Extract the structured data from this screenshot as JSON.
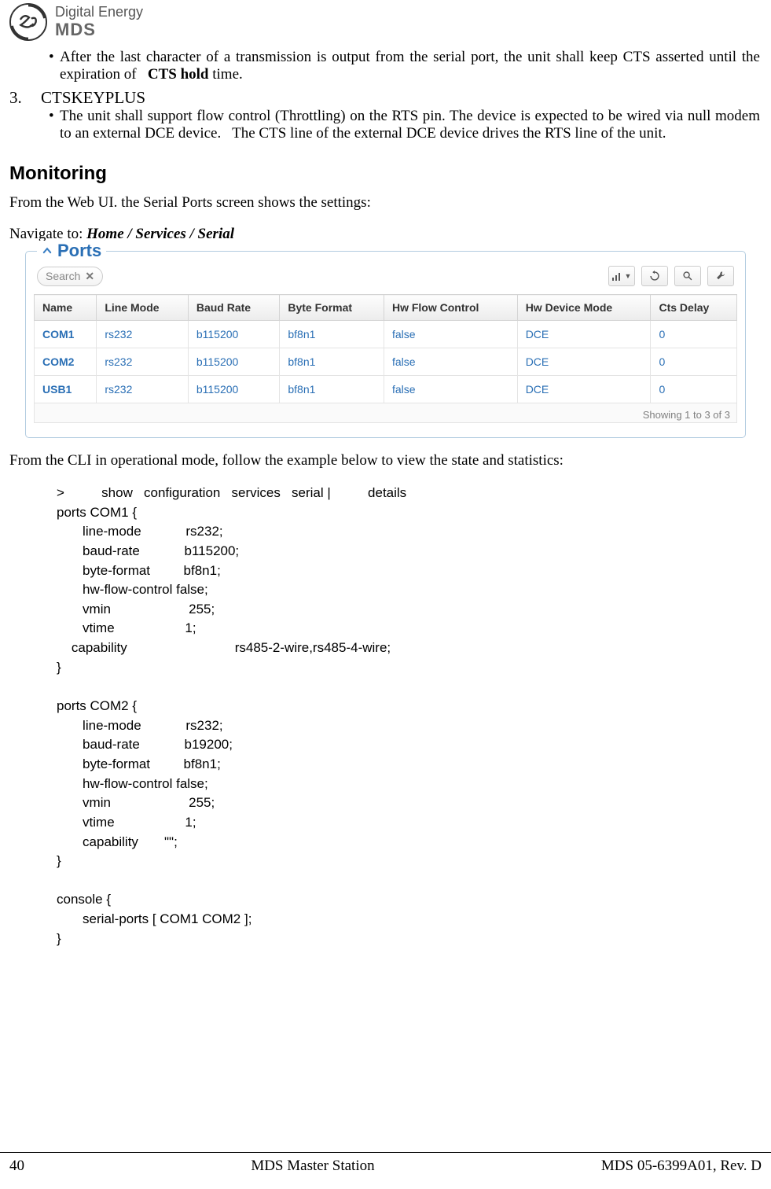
{
  "header": {
    "brand_line1": "Digital Energy",
    "brand_line2": "MDS"
  },
  "body": {
    "bullet1": "After the last character of a transmission is output from the serial port, the unit shall keep CTS asserted until the expiration of   ",
    "bullet1_bold": "CTS hold",
    "bullet1_after": " time.",
    "list3_num": "3.",
    "list3_label": "CTSKEYPLUS",
    "bullet2": "The unit shall support flow control (Throttling) on the RTS pin. The device is expected to be wired via null modem to an external DCE device.   The CTS line of the external DCE device drives the RTS line of the unit.",
    "monitoring_heading": "Monitoring",
    "mon_para1": "From the Web UI. the Serial Ports screen shows the settings:",
    "nav_prefix": "Navigate to: ",
    "nav_path": "Home / Services / Serial",
    "cli_intro": "From the CLI in operational mode, follow the example below to view the state and statistics:"
  },
  "ports_panel": {
    "title": "Ports",
    "search_placeholder": "Search",
    "columns": [
      "Name",
      "Line Mode",
      "Baud Rate",
      "Byte Format",
      "Hw Flow Control",
      "Hw Device Mode",
      "Cts Delay"
    ],
    "rows": [
      {
        "name": "COM1",
        "line_mode": "rs232",
        "baud_rate": "b115200",
        "byte_format": "bf8n1",
        "hw_flow": "false",
        "hw_device": "DCE",
        "cts_delay": "0"
      },
      {
        "name": "COM2",
        "line_mode": "rs232",
        "baud_rate": "b115200",
        "byte_format": "bf8n1",
        "hw_flow": "false",
        "hw_device": "DCE",
        "cts_delay": "0"
      },
      {
        "name": "USB1",
        "line_mode": "rs232",
        "baud_rate": "b115200",
        "byte_format": "bf8n1",
        "hw_flow": "false",
        "hw_device": "DCE",
        "cts_delay": "0"
      }
    ],
    "footer": "Showing 1 to 3 of 3"
  },
  "cli": {
    "text": ">          show   configuration   services   serial |          details\nports COM1 {\n       line-mode            rs232;\n       baud-rate            b115200;\n       byte-format         bf8n1;\n       hw-flow-control false;\n       vmin                     255;\n       vtime                   1;\n    capability                             rs485-2-wire,rs485-4-wire;\n}\n\nports COM2 {\n       line-mode            rs232;\n       baud-rate            b19200;\n       byte-format         bf8n1;\n       hw-flow-control false;\n       vmin                     255;\n       vtime                   1;\n       capability       \"\";\n}\n\nconsole {\n       serial-ports [ COM1 COM2 ];\n}"
  },
  "footer": {
    "page": "40",
    "center": "MDS Master Station",
    "right": "MDS 05-6399A01, Rev. D"
  }
}
